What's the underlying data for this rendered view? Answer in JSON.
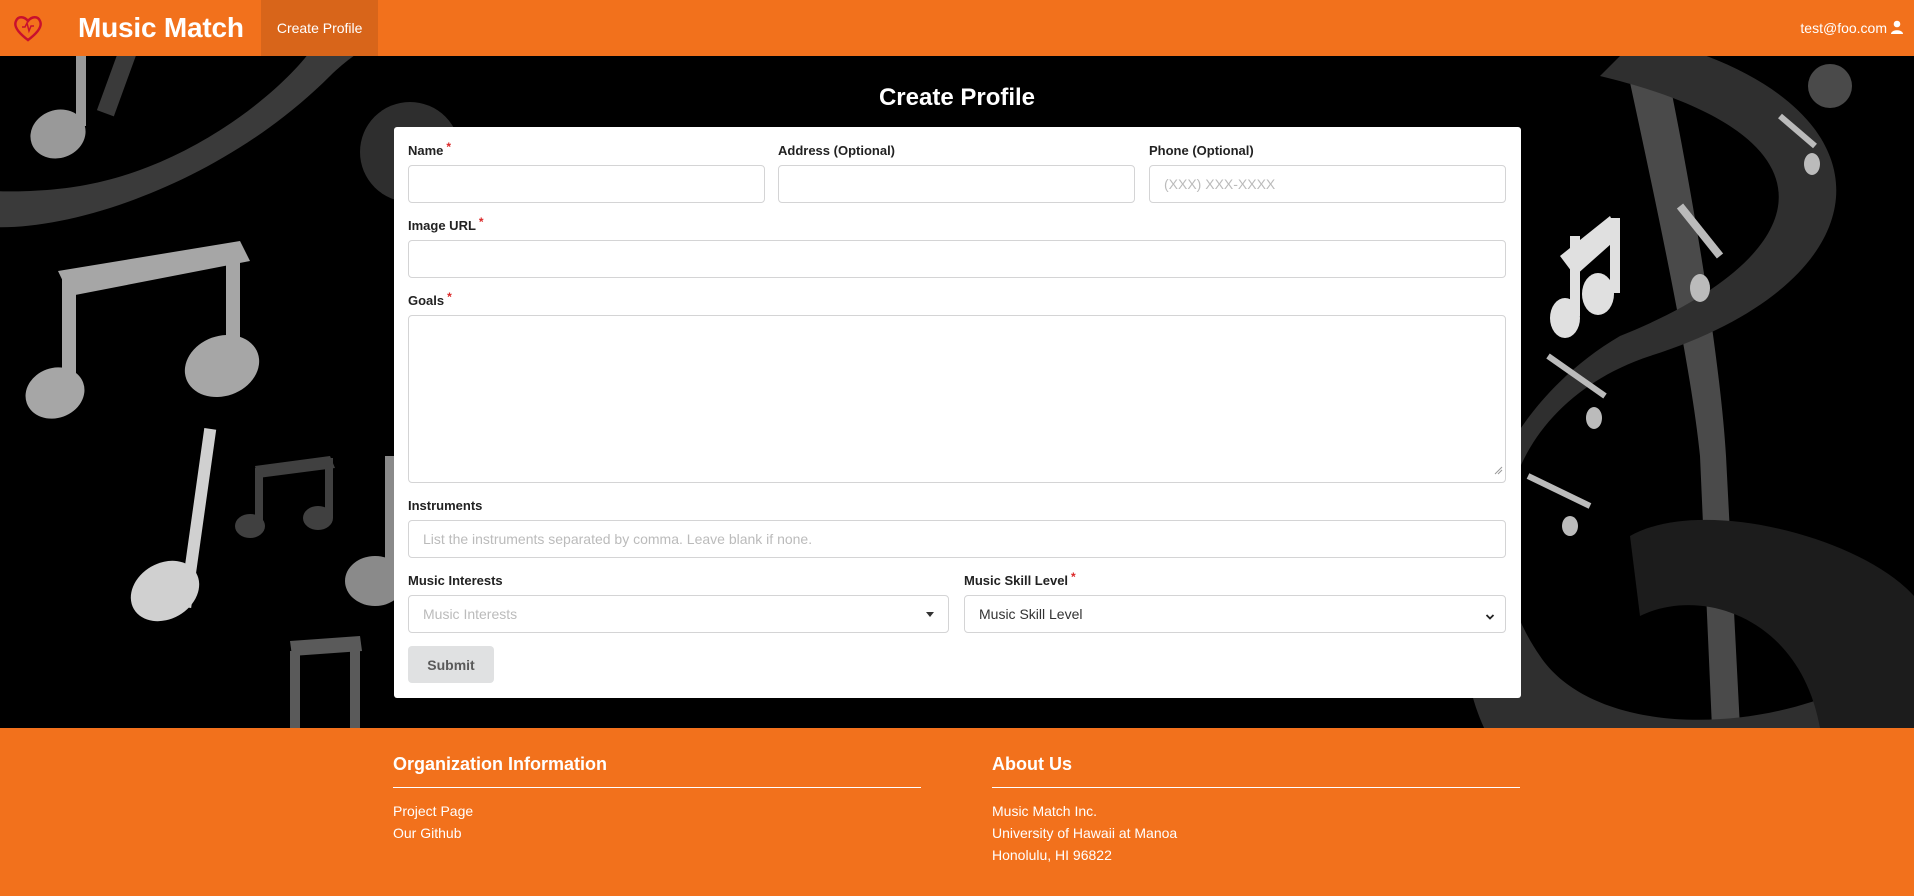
{
  "navbar": {
    "brand": "Music Match",
    "active_link": "Create Profile",
    "user_email": "test@foo.com"
  },
  "page": {
    "title": "Create Profile"
  },
  "form": {
    "name_label": "Name",
    "address_label": "Address (Optional)",
    "phone_label": "Phone (Optional)",
    "phone_placeholder": "(XXX) XXX-XXXX",
    "image_label": "Image URL",
    "goals_label": "Goals",
    "instruments_label": "Instruments",
    "instruments_placeholder": "List the instruments separated by comma. Leave blank if none.",
    "interests_label": "Music Interests",
    "interests_placeholder": "Music Interests",
    "skill_label": "Music Skill Level",
    "skill_selected": "Music Skill Level",
    "required_mark": "*",
    "submit_label": "Submit"
  },
  "footer": {
    "org": {
      "heading": "Organization Information",
      "links": [
        "Project Page",
        "Our Github"
      ]
    },
    "about": {
      "heading": "About Us",
      "lines": [
        "Music Match Inc.",
        "University of Hawaii at Manoa",
        "Honolulu, HI 96822"
      ]
    }
  },
  "colors": {
    "brand_orange": "#f2711c",
    "required_red": "#db2828",
    "hero_background": "#000000"
  }
}
